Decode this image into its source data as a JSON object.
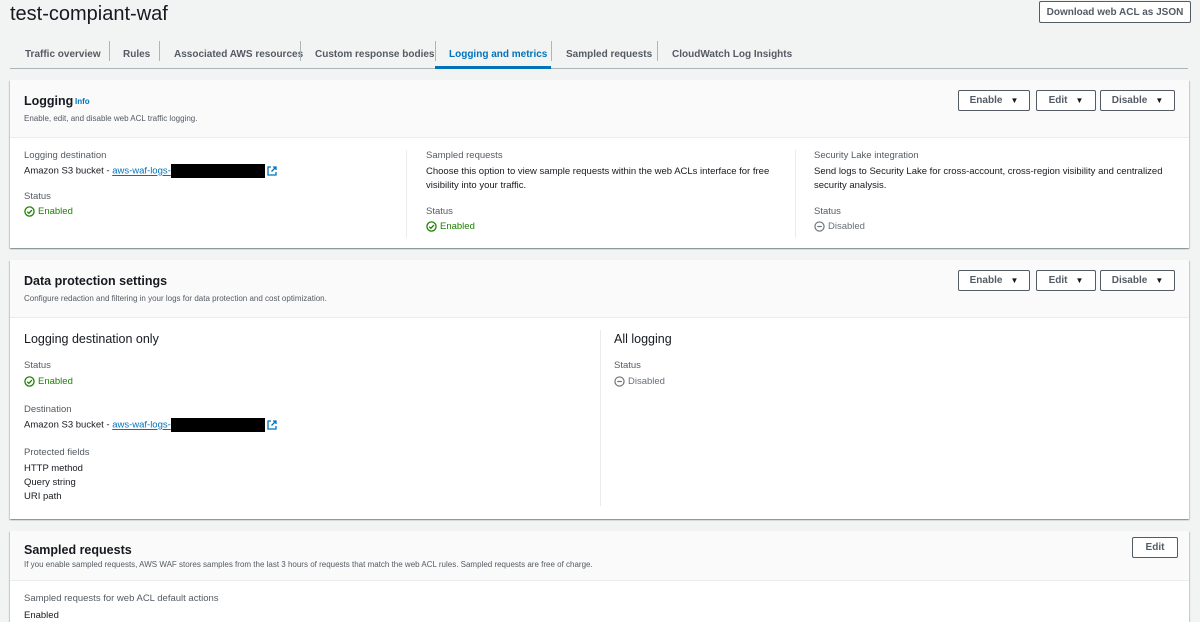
{
  "header": {
    "title": "test-compiant-waf",
    "download_label": "Download web ACL as JSON"
  },
  "tabs": [
    {
      "label": "Traffic overview"
    },
    {
      "label": "Rules"
    },
    {
      "label": "Associated AWS resources"
    },
    {
      "label": "Custom response bodies"
    },
    {
      "label": "Logging and metrics",
      "active": true
    },
    {
      "label": "Sampled requests"
    },
    {
      "label": "CloudWatch Log Insights"
    }
  ],
  "logging": {
    "title": "Logging",
    "info": "Info",
    "description": "Enable, edit, and disable web ACL traffic logging.",
    "enable_label": "Enable",
    "edit_label": "Edit",
    "disable_label": "Disable",
    "destination": {
      "label": "Logging destination",
      "prefix": "Amazon S3 bucket - ",
      "link": "aws-waf-logs-",
      "status_label": "Status",
      "status": "Enabled"
    },
    "sampled": {
      "label": "Sampled requests",
      "text": "Choose this option to view sample requests within the web ACLs interface for free visibility into your traffic.",
      "status_label": "Status",
      "status": "Enabled"
    },
    "lake": {
      "label": "Security Lake integration",
      "text": "Send logs to Security Lake for cross-account, cross-region visibility and centralized security analysis.",
      "status_label": "Status",
      "status": "Disabled"
    }
  },
  "data_protection": {
    "title": "Data protection settings",
    "description": "Configure redaction and filtering in your logs for data protection and cost optimization.",
    "enable_label": "Enable",
    "edit_label": "Edit",
    "disable_label": "Disable",
    "dest_only": {
      "heading": "Logging destination only",
      "status_label": "Status",
      "status": "Enabled",
      "destination_label": "Destination",
      "prefix": "Amazon S3 bucket - ",
      "link": "aws-waf-logs-",
      "protected_label": "Protected fields",
      "fields": [
        "HTTP method",
        "Query string",
        "URI path"
      ]
    },
    "all_logging": {
      "heading": "All logging",
      "status_label": "Status",
      "status": "Disabled"
    }
  },
  "sampled_requests": {
    "title": "Sampled requests",
    "description": "If you enable sampled requests, AWS WAF stores samples from the last 3 hours of requests that match the web ACL rules. Sampled requests are free of charge.",
    "edit_label": "Edit",
    "default_label": "Sampled requests for web ACL default actions",
    "default_value": "Enabled"
  },
  "colors": {
    "accent": "#0073bb",
    "success": "#1d8102",
    "disabled": "#687078"
  }
}
